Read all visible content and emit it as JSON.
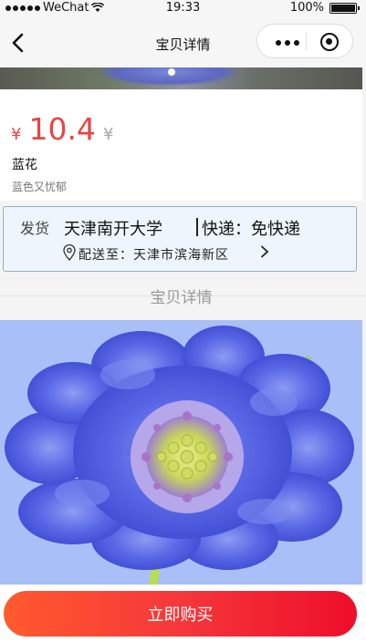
{
  "status_bar": {
    "carrier": "WeChat",
    "time": "19:33",
    "battery": "100%",
    "battery_level": 1.0
  },
  "nav": {
    "title": "宝贝详情"
  },
  "product": {
    "currency": "¥",
    "price": "10.4",
    "currency_secondary": "¥",
    "name": "蓝花",
    "description": "蓝色又忧郁"
  },
  "shipping": {
    "label": "发货",
    "from": "天津南开大学",
    "method": "快递：免快递",
    "destination": "配送至：天津市滨海新区"
  },
  "detail": {
    "section_title": "宝贝详情"
  },
  "actions": {
    "buy_label": "立即购买"
  },
  "colors": {
    "price_red": "#e94545",
    "buy_gradient_start": "#ff5a2e",
    "buy_gradient_end": "#ee0e2a",
    "detail_background": "#a9bff7",
    "shipping_box_bg": "#eef5fc"
  },
  "icons": [
    "wifi-icon",
    "back-chevron-icon",
    "more-dots-icon",
    "target-icon",
    "location-pin-icon",
    "chevron-right-icon"
  ]
}
